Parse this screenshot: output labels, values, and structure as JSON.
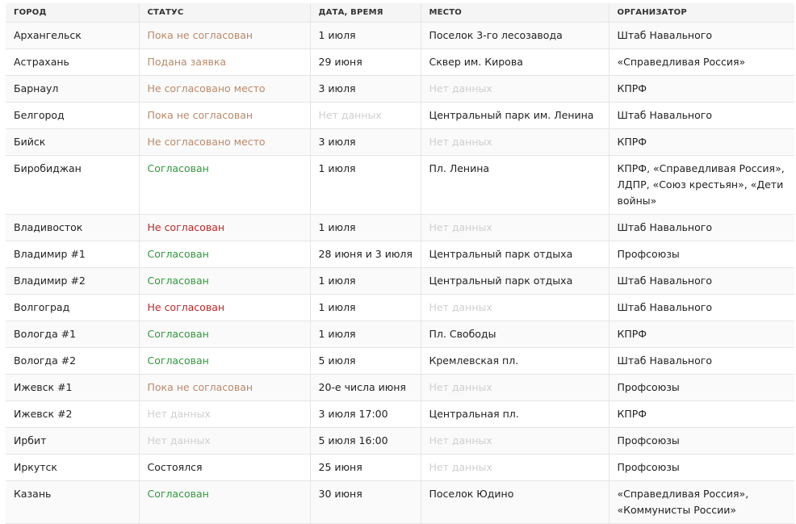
{
  "table": {
    "headers": {
      "city": "ГОРОД",
      "status": "СТАТУС",
      "date": "ДАТА, ВРЕМЯ",
      "place": "МЕСТО",
      "organizer": "ОРГАНИЗАТОР"
    },
    "rows": [
      {
        "city": "Архангельск",
        "status": "Пока не согласован",
        "date": "1 июля",
        "place": "Поселок 3-го лесозавода",
        "organizer": "Штаб Навального"
      },
      {
        "city": "Астрахань",
        "status": "Подана заявка",
        "date": "29 июня",
        "place": "Сквер им. Кирова",
        "organizer": "«Справедливая Россия»"
      },
      {
        "city": "Барнаул",
        "status": "Не согласовано место",
        "date": "3 июля",
        "place": "Нет данных",
        "organizer": "КПРФ"
      },
      {
        "city": "Белгород",
        "status": "Пока не согласован",
        "date": "Нет данных",
        "place": "Центральный парк им. Ленина",
        "organizer": "Штаб Навального"
      },
      {
        "city": "Бийск",
        "status": "Не согласовано место",
        "date": "3 июля",
        "place": "Нет данных",
        "organizer": "КПРФ"
      },
      {
        "city": "Биробиджан",
        "status": "Согласован",
        "date": "1 июля",
        "place": "Пл. Ленина",
        "organizer": "КПРФ, «Справедливая Россия», ЛДПР, «Союз крестьян», «Дети войны»"
      },
      {
        "city": "Владивосток",
        "status": "Не согласован",
        "date": "1 июля",
        "place": "Нет данных",
        "organizer": "Штаб Навального"
      },
      {
        "city": "Владимир #1",
        "status": "Согласован",
        "date": "28 июня и 3 июля",
        "place": "Центральный парк отдыха",
        "organizer": "Профсоюзы"
      },
      {
        "city": "Владимир #2",
        "status": "Согласован",
        "date": "1 июля",
        "place": "Центральный парк отдыха",
        "organizer": "Штаб Навального"
      },
      {
        "city": "Волгоград",
        "status": "Не согласован",
        "date": "1 июля",
        "place": "Нет данных",
        "organizer": "Штаб Навального"
      },
      {
        "city": "Вологда #1",
        "status": "Согласован",
        "date": "1 июля",
        "place": "Пл. Свободы",
        "organizer": "КПРФ"
      },
      {
        "city": "Вологда #2",
        "status": "Согласован",
        "date": "5 июля",
        "place": "Кремлевская пл.",
        "organizer": "Штаб Навального"
      },
      {
        "city": "Ижевск #1",
        "status": "Пока не согласован",
        "date": "20-е числа июня",
        "place": "Нет данных",
        "organizer": "Профсоюзы"
      },
      {
        "city": "Ижевск #2",
        "status": "Нет данных",
        "date": "3 июля 17:00",
        "place": "Центральная пл.",
        "organizer": "КПРФ"
      },
      {
        "city": "Ирбит",
        "status": "Нет данных",
        "date": "5 июля 16:00",
        "place": "Нет данных",
        "organizer": "Профсоюзы"
      },
      {
        "city": "Иркутск",
        "status": "Состоялся",
        "date": "25 июня",
        "place": "Нет данных",
        "organizer": "Профсоюзы"
      },
      {
        "city": "Казань",
        "status": "Согласован",
        "date": "30 июня",
        "place": "Поселок Юдино",
        "organizer": "«Справедливая Россия», «Коммунисты России»"
      }
    ]
  },
  "colors": {
    "pending": "#b88a6a",
    "approved": "#2f9a3a",
    "rejected": "#b52a2a",
    "no_data": "#cfcfcf",
    "done": "#222222"
  }
}
